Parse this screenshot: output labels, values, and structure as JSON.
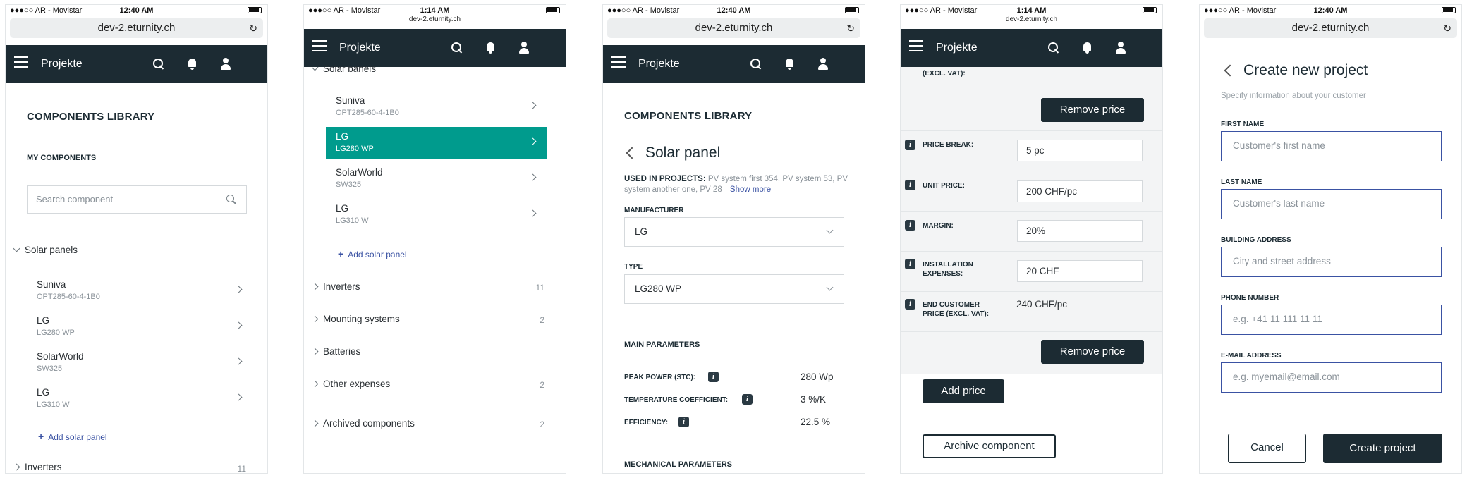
{
  "screens": [
    {
      "status": {
        "carrier": "●●●○○ AR - Movistar",
        "time": "12:40 AM",
        "right": "⊕ ➚"
      },
      "url": "dev-2.eturnity.ch",
      "nav_title": "Projekte",
      "library_title": "COMPONENTS LIBRARY",
      "my_components": "MY COMPONENTS",
      "search_placeholder": "Search component",
      "group_title": "Solar panels",
      "items": [
        {
          "name": "Suniva",
          "sub": "OPT285-60-4-1B0"
        },
        {
          "name": "LG",
          "sub": "LG280 WP"
        },
        {
          "name": "SolarWorld",
          "sub": "SW325"
        },
        {
          "name": "LG",
          "sub": "LG310 W"
        }
      ],
      "add_label": "Add solar panel",
      "inverters": "Inverters",
      "inverters_count": "11"
    },
    {
      "status": {
        "carrier": "●●●○○ AR - Movistar",
        "time": "1:14 AM",
        "right": "⊕ ➚"
      },
      "url": "dev-2.eturnity.ch",
      "nav_title": "Projekte",
      "group_title": "Solar panels",
      "items": [
        {
          "name": "Suniva",
          "sub": "OPT285-60-4-1B0"
        },
        {
          "name": "LG",
          "sub": "LG280 WP"
        },
        {
          "name": "SolarWorld",
          "sub": "SW325"
        },
        {
          "name": "LG",
          "sub": "LG310 W"
        }
      ],
      "add_label": "Add solar panel",
      "groups": [
        {
          "label": "Inverters",
          "count": "11"
        },
        {
          "label": "Mounting systems",
          "count": "2"
        },
        {
          "label": "Batteries",
          "count": ""
        },
        {
          "label": "Other expenses",
          "count": "2"
        }
      ],
      "archived": {
        "label": "Archived components",
        "count": "2"
      }
    },
    {
      "status": {
        "carrier": "●●●○○ AR - Movistar",
        "time": "12:40 AM",
        "right": "⊕ ➚"
      },
      "url": "dev-2.eturnity.ch",
      "nav_title": "Projekte",
      "library_title": "COMPONENTS LIBRARY",
      "detail_title": "Solar panel",
      "used_label": "USED IN PROJECTS:",
      "used_value": "PV system first 354, PV system 53, PV system another one, PV 28",
      "show_more": "Show more",
      "manufacturer_label": "MANUFACTURER",
      "manufacturer_value": "LG",
      "type_label": "TYPE",
      "type_value": "LG280 WP",
      "main_params": "MAIN PARAMETERS",
      "params": [
        {
          "label": "PEAK POWER (STC):",
          "value": "280 Wp"
        },
        {
          "label": "TEMPERATURE COEFFICIENT:",
          "value": "3 %/K"
        },
        {
          "label": "EFFICIENCY:",
          "value": "22.5 %"
        }
      ],
      "mech_params": "MECHANICAL PARAMETERS"
    },
    {
      "status": {
        "carrier": "●●●○○ AR - Movistar",
        "time": "1:14 AM",
        "right": "⊕ ➚"
      },
      "url": "dev-2.eturnity.ch",
      "nav_title": "Projekte",
      "top_cut": "(EXCL. VAT):",
      "remove_price": "Remove price",
      "rows": [
        {
          "label": "PRICE BREAK:",
          "value": "5 pc"
        },
        {
          "label": "UNIT PRICE:",
          "value": "200 CHF/pc"
        },
        {
          "label": "MARGIN:",
          "value": "20%"
        },
        {
          "label": "INSTALLATION EXPENSES:",
          "value": "20 CHF"
        },
        {
          "label": "END CUSTOMER PRICE (EXCL. VAT):",
          "value": "240 CHF/pc"
        }
      ],
      "add_price": "Add price",
      "archive_component": "Archive component"
    },
    {
      "status": {
        "carrier": "●●●○○ AR - Movistar",
        "time": "12:40 AM",
        "right": "⊕ ➚"
      },
      "url": "dev-2.eturnity.ch",
      "title": "Create new project",
      "subtitle": "Specify information about your customer",
      "fields": [
        {
          "label": "FIRST NAME",
          "placeholder": "Customer's first name"
        },
        {
          "label": "LAST NAME",
          "placeholder": "Customer's last name"
        },
        {
          "label": "BUILDING ADDRESS",
          "placeholder": "City and street address"
        },
        {
          "label": "PHONE NUMBER",
          "placeholder": "e.g. +41 11 111 11 11"
        },
        {
          "label": "E-MAIL ADDRESS",
          "placeholder": "e.g. myemail@email.com"
        }
      ],
      "cancel": "Cancel",
      "create": "Create project"
    }
  ]
}
